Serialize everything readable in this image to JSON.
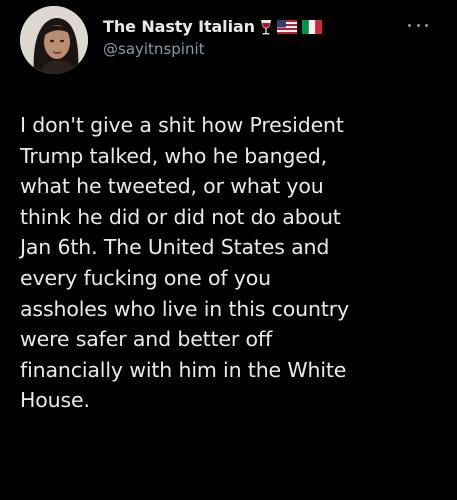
{
  "tweet": {
    "author": {
      "display_name": "The Nasty Italian",
      "handle": "@sayitnspinit",
      "name_emojis": [
        "wine-glass-icon",
        "us-flag-icon",
        "italy-flag-icon"
      ]
    },
    "more_icon": "more-options-icon",
    "text_lines": [
      "I don't give a shit how President",
      "Trump talked, who he banged,",
      "what he tweeted, or what you",
      "think he did or did not do about",
      "Jan 6th. The United States and",
      "every fucking one of you",
      "assholes who live in this country",
      "were safer and better off",
      "financially with him in the White",
      "House."
    ]
  },
  "colors": {
    "background": "#000000",
    "text_primary": "#e7e9ea",
    "text_secondary": "#8b98a5"
  }
}
